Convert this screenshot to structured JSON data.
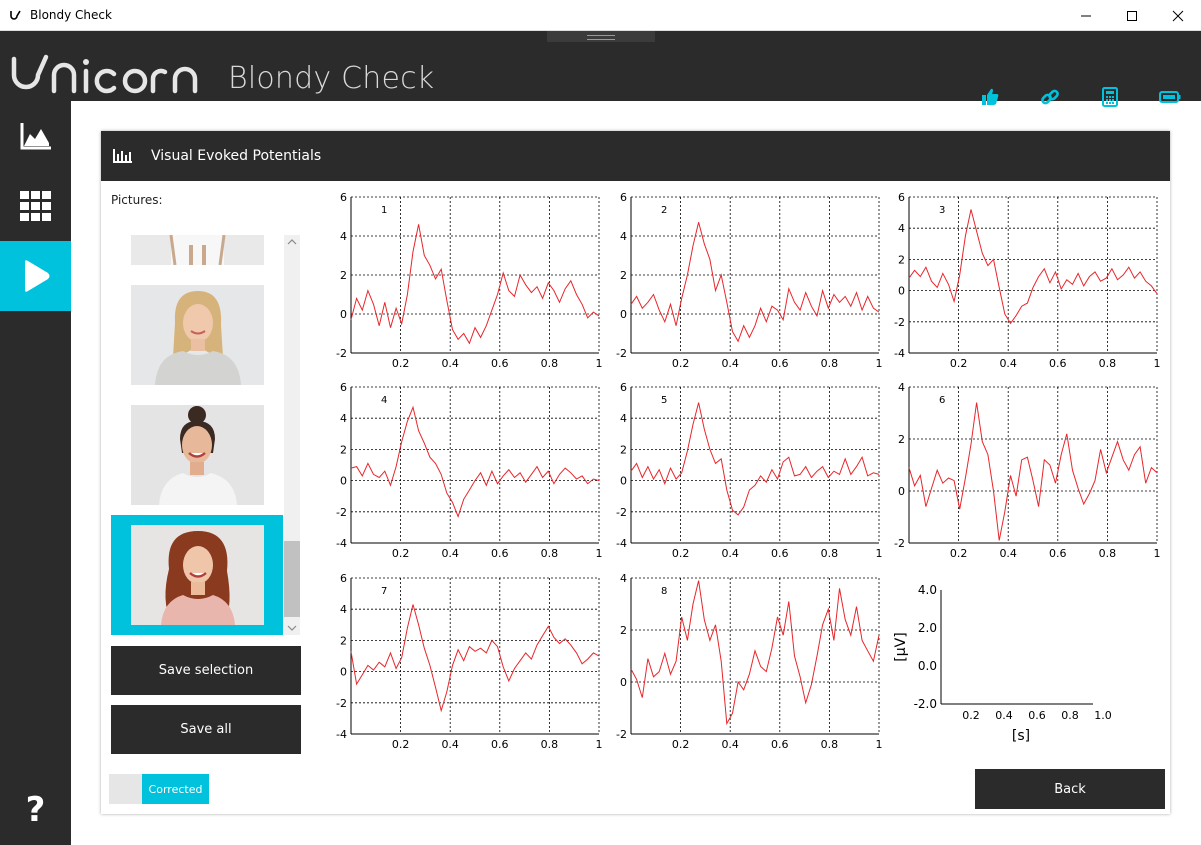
{
  "window": {
    "title": "Blondy Check"
  },
  "header": {
    "logo_text": "unicorn",
    "subtitle": "Blondy Check"
  },
  "header_icons": [
    "thumbs-up-icon",
    "link-icon",
    "calculator-icon",
    "battery-icon"
  ],
  "sidebar": {
    "items": [
      {
        "icon": "chart-icon",
        "active": false
      },
      {
        "icon": "grid-icon",
        "active": false
      },
      {
        "icon": "play-icon",
        "active": true
      }
    ],
    "help_label": "?"
  },
  "panel": {
    "title": "Visual Evoked Potentials"
  },
  "pictures": {
    "label": "Pictures:",
    "items": [
      {
        "name": "picture-partial",
        "selected": false
      },
      {
        "name": "picture-blonde-woman",
        "selected": false
      },
      {
        "name": "picture-dark-hair-woman",
        "selected": false
      },
      {
        "name": "picture-red-hair-woman",
        "selected": true
      }
    ]
  },
  "buttons": {
    "save_selection": "Save selection",
    "save_all": "Save all",
    "back": "Back"
  },
  "toggle": {
    "label": "Corrected",
    "on": true
  },
  "colors": {
    "accent": "#00c2dc",
    "dark": "#2b2b2b",
    "trace": "#e8262b"
  },
  "chart_data": {
    "type": "line",
    "x_ticks": [
      "0.2",
      "0.4",
      "0.6",
      "0.8",
      "1"
    ],
    "plots": [
      {
        "id": "1",
        "y_ticks": [
          "6",
          "4",
          "2",
          "0",
          "-2"
        ],
        "ylim": [
          -2,
          6
        ],
        "values": [
          -0.3,
          0.8,
          0.2,
          1.2,
          0.5,
          -0.6,
          0.6,
          -0.7,
          0.3,
          -0.5,
          1.0,
          3.2,
          4.6,
          3.0,
          2.5,
          1.8,
          2.3,
          0.7,
          -0.8,
          -1.3,
          -1.0,
          -1.5,
          -0.7,
          -1.2,
          -0.6,
          0.2,
          1.0,
          2.1,
          1.2,
          0.9,
          2.0,
          1.5,
          1.1,
          1.4,
          0.8,
          1.6,
          1.2,
          0.6,
          1.3,
          1.7,
          1.0,
          0.5,
          -0.2,
          0.1,
          -0.1
        ]
      },
      {
        "id": "2",
        "y_ticks": [
          "6",
          "4",
          "2",
          "0",
          "-2"
        ],
        "ylim": [
          -2,
          6
        ],
        "values": [
          0.5,
          0.9,
          0.3,
          0.6,
          1.0,
          0.2,
          -0.4,
          0.5,
          -0.6,
          0.8,
          2.0,
          3.5,
          4.7,
          3.6,
          2.8,
          1.2,
          2.0,
          0.6,
          -0.9,
          -1.4,
          -0.6,
          -1.2,
          -0.6,
          0.3,
          -0.4,
          0.4,
          0.2,
          -0.3,
          1.3,
          0.6,
          0.2,
          1.1,
          0.4,
          -0.1,
          1.2,
          0.3,
          1.0,
          0.6,
          0.9,
          0.4,
          1.1,
          0.2,
          0.9,
          0.3,
          0.1
        ]
      },
      {
        "id": "3",
        "y_ticks": [
          "6",
          "4",
          "2",
          "0",
          "-2",
          "-4"
        ],
        "ylim": [
          -4,
          6
        ],
        "values": [
          0.8,
          1.3,
          0.9,
          1.5,
          0.6,
          0.2,
          1.1,
          0.4,
          -0.7,
          1.0,
          3.5,
          5.2,
          3.8,
          2.4,
          1.6,
          2.0,
          0.2,
          -1.5,
          -2.1,
          -1.6,
          -1.0,
          -0.8,
          0.2,
          0.9,
          1.4,
          0.5,
          1.2,
          0.1,
          0.7,
          0.4,
          1.1,
          0.3,
          0.9,
          1.2,
          0.6,
          0.8,
          1.4,
          0.7,
          1.0,
          1.5,
          0.8,
          1.2,
          0.6,
          0.3,
          -0.2
        ]
      },
      {
        "id": "4",
        "y_ticks": [
          "6",
          "4",
          "2",
          "0",
          "-2",
          "-4"
        ],
        "ylim": [
          -4,
          6
        ],
        "values": [
          0.8,
          0.9,
          0.3,
          1.1,
          0.4,
          0.2,
          0.6,
          -0.3,
          0.9,
          2.5,
          3.8,
          4.7,
          3.2,
          2.4,
          1.5,
          1.1,
          0.4,
          -0.8,
          -1.4,
          -2.3,
          -1.2,
          -0.6,
          0.0,
          0.5,
          -0.3,
          0.6,
          -0.2,
          0.3,
          0.7,
          0.2,
          0.5,
          -0.1,
          0.4,
          0.9,
          0.2,
          0.6,
          -0.2,
          0.4,
          0.8,
          0.5,
          0.1,
          0.3,
          -0.2,
          0.1,
          0.0
        ]
      },
      {
        "id": "5",
        "y_ticks": [
          "6",
          "4",
          "2",
          "0",
          "-2",
          "-4"
        ],
        "ylim": [
          -4,
          6
        ],
        "values": [
          0.6,
          1.1,
          0.2,
          0.9,
          0.1,
          0.7,
          -0.2,
          0.8,
          0.1,
          0.5,
          1.9,
          3.6,
          5.0,
          3.3,
          2.0,
          1.1,
          1.4,
          -0.6,
          -1.9,
          -2.2,
          -1.7,
          -0.6,
          -0.3,
          0.3,
          -0.1,
          0.7,
          0.1,
          1.2,
          1.5,
          0.3,
          0.4,
          0.9,
          0.2,
          0.6,
          0.9,
          0.2,
          0.6,
          0.4,
          1.4,
          0.4,
          0.9,
          1.5,
          0.3,
          0.5,
          0.4
        ]
      },
      {
        "id": "6",
        "y_ticks": [
          "4",
          "2",
          "0",
          "-2"
        ],
        "ylim": [
          -2,
          4
        ],
        "values": [
          0.9,
          0.2,
          0.6,
          -0.6,
          0.1,
          0.8,
          0.3,
          0.5,
          0.4,
          -0.7,
          0.5,
          1.8,
          3.4,
          1.9,
          1.4,
          0.0,
          -1.9,
          -0.8,
          0.6,
          -0.2,
          1.2,
          1.3,
          0.4,
          -0.6,
          1.2,
          1.0,
          0.3,
          1.4,
          2.2,
          0.8,
          0.1,
          -0.5,
          -0.1,
          0.4,
          1.6,
          0.7,
          1.3,
          1.9,
          1.2,
          0.8,
          1.4,
          1.7,
          0.3,
          0.9,
          0.7
        ]
      },
      {
        "id": "7",
        "y_ticks": [
          "6",
          "4",
          "2",
          "0",
          "-2",
          "-4"
        ],
        "ylim": [
          -4,
          6
        ],
        "values": [
          1.3,
          -0.8,
          -0.2,
          0.4,
          0.1,
          0.6,
          0.3,
          1.2,
          0.2,
          0.9,
          2.8,
          4.3,
          3.0,
          1.5,
          0.4,
          -1.0,
          -2.5,
          -1.3,
          0.4,
          1.4,
          0.7,
          1.6,
          1.3,
          1.5,
          1.2,
          2.0,
          1.6,
          0.3,
          -0.6,
          0.2,
          0.7,
          1.2,
          0.8,
          1.7,
          2.3,
          2.9,
          2.2,
          1.8,
          2.1,
          1.7,
          1.2,
          0.5,
          0.8,
          1.2,
          1.0
        ]
      },
      {
        "id": "8",
        "y_ticks": [
          "4",
          "2",
          "0",
          "-2"
        ],
        "ylim": [
          -2,
          4
        ],
        "values": [
          0.5,
          0.1,
          -0.6,
          0.9,
          0.2,
          0.4,
          1.1,
          0.3,
          0.8,
          2.5,
          1.6,
          3.0,
          3.9,
          2.4,
          1.6,
          2.2,
          0.8,
          -1.6,
          -1.2,
          0.0,
          -0.3,
          0.3,
          1.2,
          0.6,
          0.4,
          1.3,
          2.5,
          1.8,
          3.1,
          1.0,
          0.2,
          -0.8,
          -0.1,
          1.0,
          2.2,
          2.8,
          1.6,
          3.6,
          2.4,
          1.8,
          2.9,
          1.6,
          1.2,
          0.8,
          1.8
        ]
      }
    ],
    "scale_bar": {
      "y_ticks": [
        "4.0",
        "2.0",
        "0.0",
        "-2.0"
      ],
      "x_ticks": [
        "0.2",
        "0.4",
        "0.6",
        "0.8",
        "1.0"
      ],
      "ylabel": "[µV]",
      "xlabel": "[s]"
    }
  }
}
